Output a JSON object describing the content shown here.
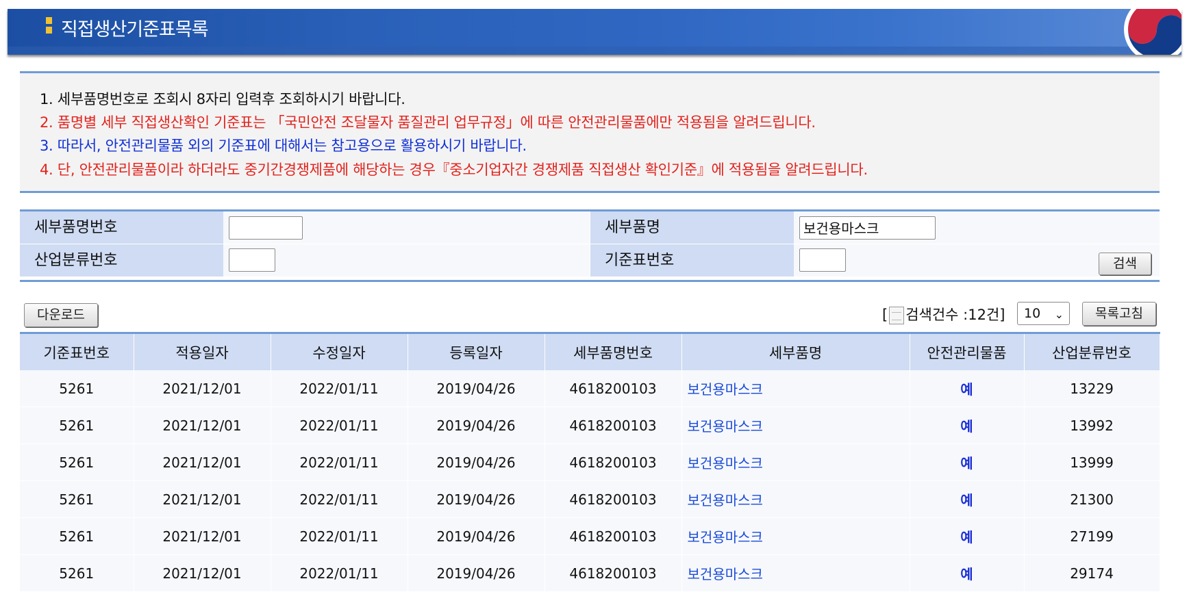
{
  "header": {
    "title": "직접생산기준표목록"
  },
  "notices": [
    "1. 세부품명번호로 조회시 8자리 입력후 조회하시기 바랍니다.",
    "2. 품명별 세부 직접생산확인 기준표는 「국민안전 조달물자 품질관리 업무규정」에 따른 안전관리물품에만 적용됨을 알려드립니다.",
    "3. 따라서, 안전관리물품 외의 기준표에 대해서는 참고용으로 활용하시기 바랍니다.",
    "4. 단, 안전관리물품이라 하더라도 중기간경쟁제품에 해당하는 경우『중소기업자간 경쟁제품 직접생산 확인기준』에 적용됨을 알려드립니다."
  ],
  "search": {
    "detail_no_label": "세부품명번호",
    "detail_no_value": "",
    "detail_name_label": "세부품명",
    "detail_name_value": "보건용마스크",
    "industry_no_label": "산업분류번호",
    "industry_no_value": "",
    "standard_no_label": "기준표번호",
    "standard_no_value": "",
    "search_button": "검색"
  },
  "toolbar": {
    "download_button": "다운로드",
    "count_prefix": "[",
    "count_text": "검색건수 :12건]",
    "page_size": "10",
    "refresh_button": "목록고침"
  },
  "table": {
    "headers": [
      "기준표번호",
      "적용일자",
      "수정일자",
      "등록일자",
      "세부품명번호",
      "세부품명",
      "안전관리물품",
      "산업분류번호"
    ],
    "rows": [
      [
        "5261",
        "2021/12/01",
        "2022/01/11",
        "2019/04/26",
        "4618200103",
        "보건용마스크",
        "예",
        "13229"
      ],
      [
        "5261",
        "2021/12/01",
        "2022/01/11",
        "2019/04/26",
        "4618200103",
        "보건용마스크",
        "예",
        "13992"
      ],
      [
        "5261",
        "2021/12/01",
        "2022/01/11",
        "2019/04/26",
        "4618200103",
        "보건용마스크",
        "예",
        "13999"
      ],
      [
        "5261",
        "2021/12/01",
        "2022/01/11",
        "2019/04/26",
        "4618200103",
        "보건용마스크",
        "예",
        "21300"
      ],
      [
        "5261",
        "2021/12/01",
        "2022/01/11",
        "2019/04/26",
        "4618200103",
        "보건용마스크",
        "예",
        "27199"
      ],
      [
        "5261",
        "2021/12/01",
        "2022/01/11",
        "2019/04/26",
        "4618200103",
        "보건용마스크",
        "예",
        "29174"
      ]
    ]
  }
}
